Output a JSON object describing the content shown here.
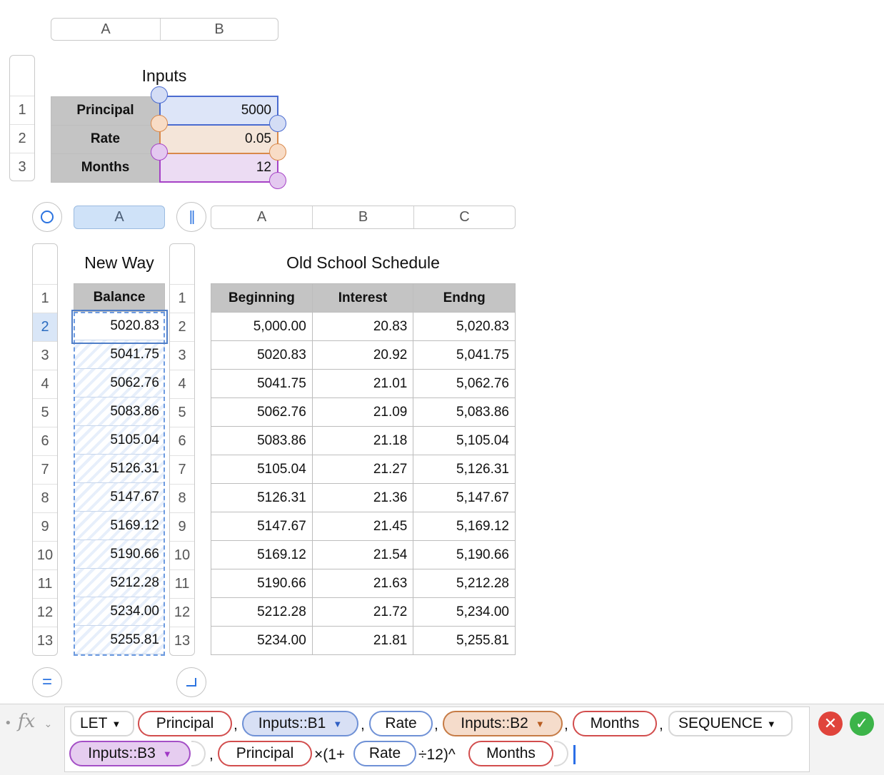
{
  "inputs_table": {
    "column_headers": [
      "A",
      "B"
    ],
    "row_numbers": [
      "1",
      "2",
      "3"
    ],
    "title": "Inputs",
    "rows": [
      {
        "label": "Principal",
        "value": "5000"
      },
      {
        "label": "Rate",
        "value": "0.05"
      },
      {
        "label": "Months",
        "value": "12"
      }
    ]
  },
  "new_way_table": {
    "column_header": "A",
    "title": "New Way",
    "row_numbers": [
      "1",
      "2",
      "3",
      "4",
      "5",
      "6",
      "7",
      "8",
      "9",
      "10",
      "11",
      "12",
      "13"
    ],
    "header": "Balance",
    "values": [
      "5020.83",
      "5041.75",
      "5062.76",
      "5083.86",
      "5105.04",
      "5126.31",
      "5147.67",
      "5169.12",
      "5190.66",
      "5212.28",
      "5234.00",
      "5255.81"
    ]
  },
  "old_school_table": {
    "column_headers": [
      "A",
      "B",
      "C"
    ],
    "title": "Old School Schedule",
    "row_numbers": [
      "1",
      "2",
      "3",
      "4",
      "5",
      "6",
      "7",
      "8",
      "9",
      "10",
      "11",
      "12",
      "13"
    ],
    "headers": [
      "Beginning",
      "Interest",
      "Endng"
    ],
    "rows": [
      [
        "5,000.00",
        "20.83",
        "5,020.83"
      ],
      [
        "5020.83",
        "20.92",
        "5,041.75"
      ],
      [
        "5041.75",
        "21.01",
        "5,062.76"
      ],
      [
        "5062.76",
        "21.09",
        "5,083.86"
      ],
      [
        "5083.86",
        "21.18",
        "5,105.04"
      ],
      [
        "5105.04",
        "21.27",
        "5,126.31"
      ],
      [
        "5126.31",
        "21.36",
        "5,147.67"
      ],
      [
        "5147.67",
        "21.45",
        "5,169.12"
      ],
      [
        "5169.12",
        "21.54",
        "5,190.66"
      ],
      [
        "5190.66",
        "21.63",
        "5,212.28"
      ],
      [
        "5212.28",
        "21.72",
        "5,234.00"
      ],
      [
        "5234.00",
        "21.81",
        "5,255.81"
      ]
    ]
  },
  "formula_bar": {
    "fx_label": "fx",
    "tokens": {
      "let": "LET",
      "principal": "Principal",
      "ref_b1": "Inputs::B1",
      "rate": "Rate",
      "ref_b2": "Inputs::B2",
      "months": "Months",
      "sequence": "SEQUENCE",
      "ref_b3": "Inputs::B3",
      "principal2": "Principal",
      "rate2": "Rate",
      "months2": "Months"
    },
    "operators": {
      "comma": ",",
      "times_open": "×(1+",
      "div_twelve_close": "÷12)^"
    }
  },
  "colors": {
    "selection_blue": "#2b6cc0",
    "ref_blue": "#4a6bd0",
    "ref_orange": "#d9894b",
    "ref_purple": "#a642c6",
    "cancel_red": "#e0443c",
    "accept_green": "#3cb449"
  },
  "icons": {
    "select_table": "circle-icon",
    "pause_handle": "pause-icon",
    "equals_handle": "equals-icon",
    "corner_handle": "corner-icon",
    "cancel": "x-icon",
    "accept": "checkmark-icon"
  }
}
